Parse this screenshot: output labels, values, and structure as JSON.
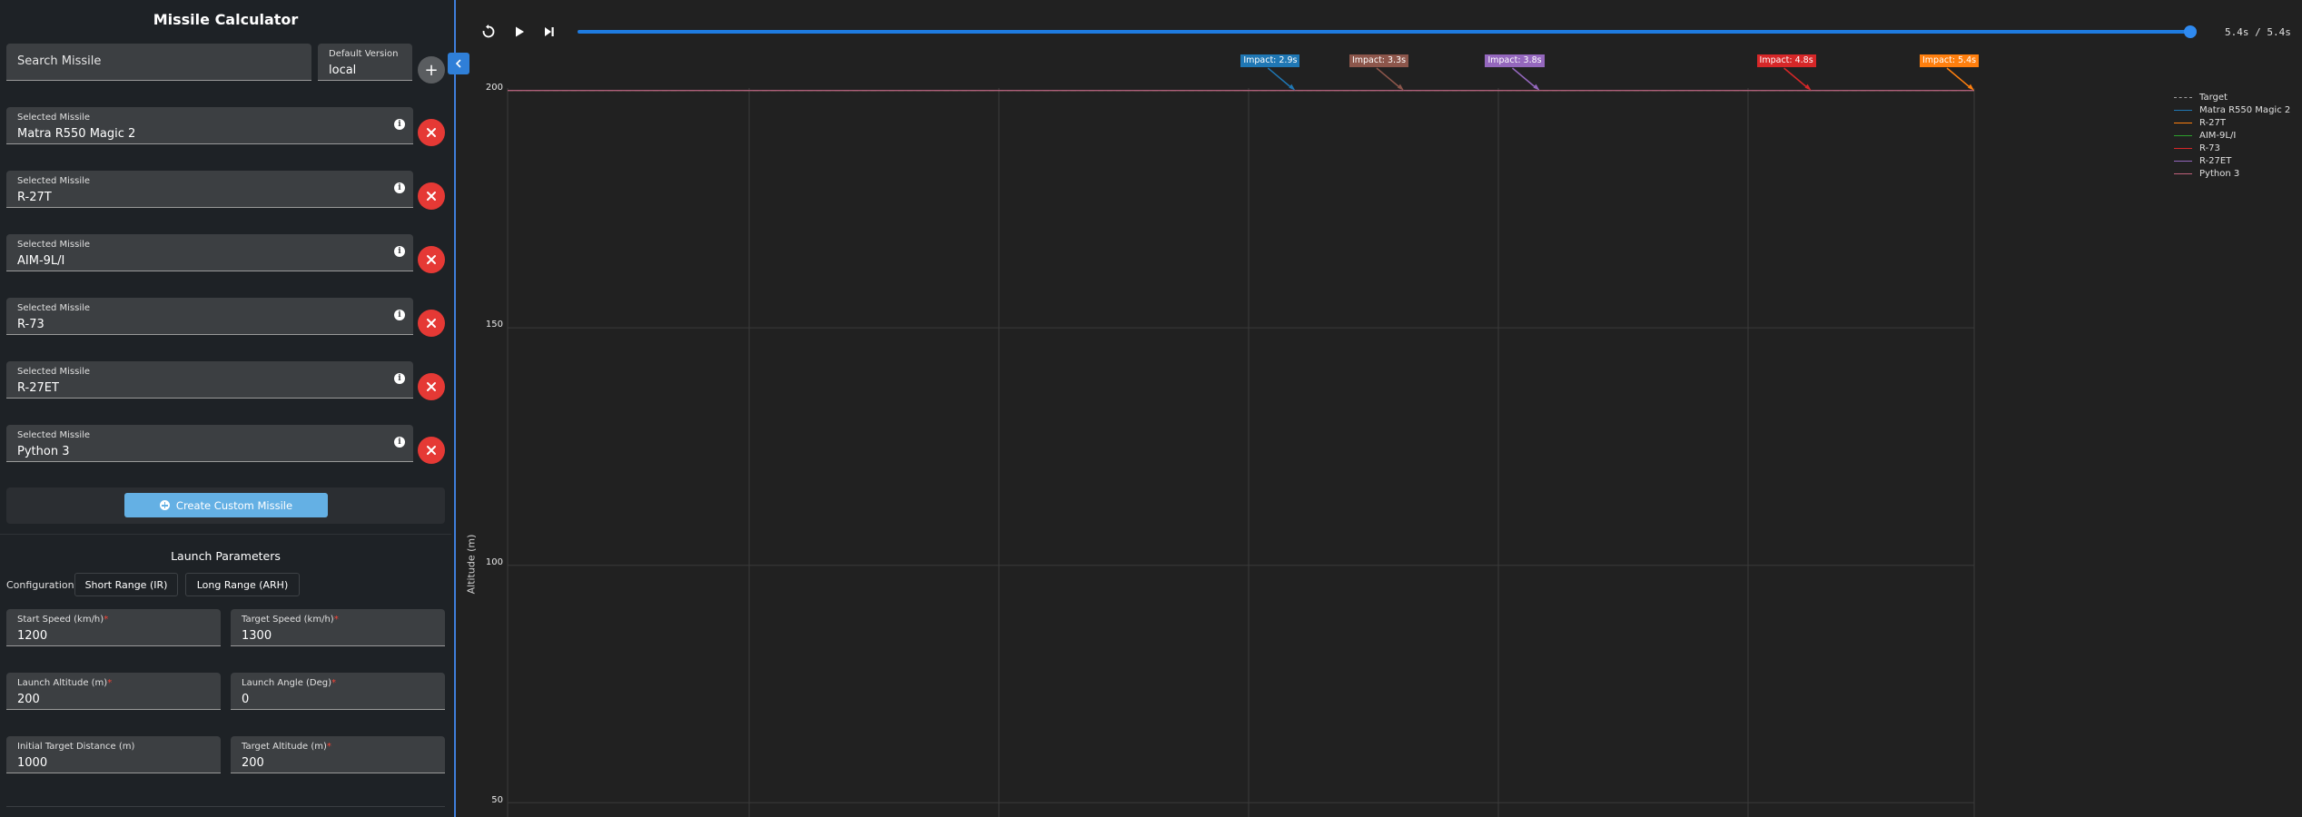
{
  "sidebar": {
    "title": "Missile Calculator",
    "search": {
      "value": "Search Missile"
    },
    "default_version": {
      "label": "Default Version",
      "value": "local"
    },
    "add_label": "+",
    "missiles": [
      {
        "label": "Selected Missile",
        "value": "Matra R550 Magic 2"
      },
      {
        "label": "Selected Missile",
        "value": "R-27T"
      },
      {
        "label": "Selected Missile",
        "value": "AIM-9L/I"
      },
      {
        "label": "Selected Missile",
        "value": "R-73"
      },
      {
        "label": "Selected Missile",
        "value": "R-27ET"
      },
      {
        "label": "Selected Missile",
        "value": "Python 3"
      }
    ],
    "create_custom_label": "Create Custom Missile",
    "launch_parameters_title": "Launch Parameters",
    "configuration_label": "Configuration:",
    "config_buttons": [
      "Short Range (IR)",
      "Long Range (ARH)"
    ],
    "params": [
      {
        "label": "Start Speed (km/h)",
        "required": "*",
        "value": "1200"
      },
      {
        "label": "Target Speed (km/h)",
        "required": "*",
        "value": "1300"
      },
      {
        "label": "Launch Altitude (m)",
        "required": "*",
        "value": "200"
      },
      {
        "label": "Launch Angle (Deg)",
        "required": "*",
        "value": "0"
      },
      {
        "label": "Initial Target Distance (m)",
        "required": "",
        "value": "1000"
      },
      {
        "label": "Target Altitude (m)",
        "required": "*",
        "value": "200"
      }
    ]
  },
  "playback": {
    "time_readout": "5.4s / 5.4s",
    "progress": 1.0
  },
  "chart_data": {
    "type": "line",
    "ylabel": "Altitude (m)",
    "ytick_labels": [
      "200",
      "150",
      "100",
      "50"
    ],
    "yticks": [
      200,
      150,
      100,
      50
    ],
    "ylim": [
      47,
      200.5
    ],
    "grid": true,
    "legend_position": "top-right",
    "legend": [
      {
        "name": "Target",
        "color": "#9e9e9e",
        "dashed": true
      },
      {
        "name": "Matra R550 Magic 2",
        "color": "#1f77b4",
        "dashed": false
      },
      {
        "name": "R-27T",
        "color": "#ff7f0e",
        "dashed": false
      },
      {
        "name": "AIM-9L/I",
        "color": "#2ca02c",
        "dashed": false
      },
      {
        "name": "R-73",
        "color": "#d62728",
        "dashed": false
      },
      {
        "name": "R-27ET",
        "color": "#9467bd",
        "dashed": false
      },
      {
        "name": "Python 3",
        "color": "#c0607a",
        "dashed": false
      }
    ],
    "impacts": [
      {
        "text": "Impact: 2.9s",
        "time": 2.9,
        "color": "#1f77b4"
      },
      {
        "text": "Impact: 3.3s",
        "time": 3.3,
        "color": "#8c564b"
      },
      {
        "text": "Impact: 3.8s",
        "time": 3.8,
        "color": "#9467bd"
      },
      {
        "text": "Impact: 4.8s",
        "time": 4.8,
        "color": "#d62728"
      },
      {
        "text": "Impact: 5.4s",
        "time": 5.4,
        "color": "#ff7f0e"
      }
    ],
    "altitude_constant": 200
  }
}
